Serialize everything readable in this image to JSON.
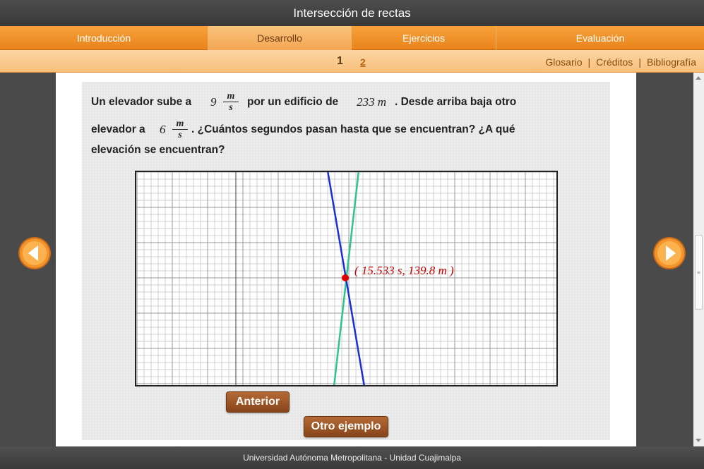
{
  "window": {
    "title": "Intersección de rectas"
  },
  "nav": {
    "tabs": [
      {
        "label": "Introducción"
      },
      {
        "label": "Desarrollo",
        "active": true
      },
      {
        "label": "Ejercicios"
      },
      {
        "label": "Evaluación"
      }
    ]
  },
  "subnav": {
    "pages": [
      {
        "label": "1",
        "current": true
      },
      {
        "label": "2"
      }
    ],
    "links": [
      "Glosario",
      "Créditos",
      "Bibliografía"
    ],
    "separator": "|"
  },
  "problem": {
    "part1": "Un elevador sube a",
    "speed_up": "9",
    "part2": "por un edificio de",
    "height": "233",
    "height_unit": "m",
    "part3": ". Desde arriba baja otro",
    "part4": "elevador a",
    "speed_down": "6",
    "part5": ". ¿Cuántos segundos pasan hasta que se encuentran? ¿A qué",
    "part6": "elevación se encuentran?",
    "unit_num": "m",
    "unit_den": "s"
  },
  "graph": {
    "intersection_label": "( 15.533 s, 139.8 m )",
    "line_down_color": "#1a2fd6",
    "line_up_color": "#2ec48a",
    "point_color": "#dd0000",
    "label_color": "#c00000"
  },
  "buttons": {
    "previous": "Anterior",
    "another_example": "Otro ejemplo"
  },
  "footer": {
    "text": "Universidad Autónoma Metropolitana - Unidad Cuajimalpa"
  },
  "colors": {
    "accent_orange": "#f39a2e",
    "button_brown": "#9a5222"
  }
}
